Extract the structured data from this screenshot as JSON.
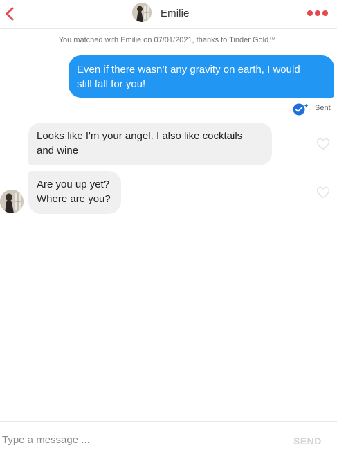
{
  "colors": {
    "accent_red": "#e5494d",
    "outgoing_bubble": "#2196f3",
    "incoming_bubble": "#f0f0f0",
    "sent_badge": "#1e6fd9"
  },
  "header": {
    "contact_name": "Emilie",
    "back_icon": "chevron-left-icon",
    "more_icon": "more-dots-icon"
  },
  "match_notice": "You matched with Emilie on 07/01/2021, thanks to Tinder Gold™.",
  "messages": [
    {
      "direction": "outgoing",
      "lines": [
        "Even if there wasn’t any gravity on earth, I would",
        "still fall for you!"
      ],
      "status": "Sent"
    },
    {
      "direction": "incoming",
      "lines": [
        "Looks like I'm your angel. I also like cocktails",
        "and wine"
      ]
    },
    {
      "direction": "incoming",
      "lines": [
        "Are you up yet?",
        "Where are you?"
      ]
    }
  ],
  "composer": {
    "placeholder": "Type a message ...",
    "value": "",
    "send_label": "SEND"
  }
}
